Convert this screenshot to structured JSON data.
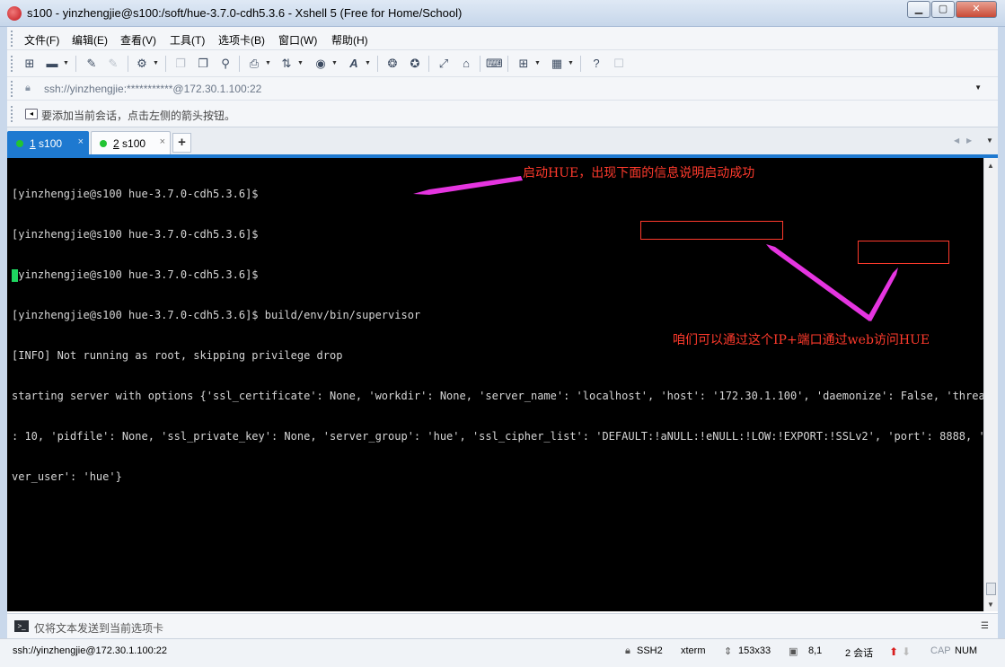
{
  "window": {
    "title": "s100 - yinzhengjie@s100:/soft/hue-3.7.0-cdh5.3.6 - Xshell 5 (Free for Home/School)",
    "min_glyph": "▁",
    "max_glyph": "▢",
    "close_glyph": "✕"
  },
  "menu": {
    "items": [
      "文件(F)",
      "编辑(E)",
      "查看(V)",
      "工具(T)",
      "选项卡(B)",
      "窗口(W)",
      "帮助(H)"
    ]
  },
  "toolbar": {
    "icons": [
      "new-session-icon",
      "open-folder-icon",
      "connect-icon",
      "disconnect-icon",
      "properties-icon",
      "copy-icon",
      "paste-icon",
      "find-icon",
      "print-icon",
      "transfer-icon",
      "globe-icon",
      "font-icon",
      "xftp-icon",
      "xmanager-icon",
      "fullscreen-icon",
      "lock-icon",
      "keyboard-icon",
      "add-tab-icon",
      "layout-icon",
      "help-icon",
      "chat-icon"
    ]
  },
  "address": {
    "value": "ssh://yinzhengjie:***********@172.30.1.100:22",
    "dropdown_glyph": "▼"
  },
  "tip": {
    "text": "要添加当前会话，点击左侧的箭头按钮。"
  },
  "tabs": [
    {
      "number": "1",
      "name": " s100",
      "close": "×",
      "status_color": "#22c432"
    },
    {
      "number": "2",
      "name": " s100",
      "close": "×",
      "status_color": "#22c432"
    }
  ],
  "tab_add_label": "+",
  "terminal": {
    "lines": [
      "[yinzhengjie@s100 hue-3.7.0-cdh5.3.6]$",
      "[yinzhengjie@s100 hue-3.7.0-cdh5.3.6]$",
      "[yinzhengjie@s100 hue-3.7.0-cdh5.3.6]$",
      "[yinzhengjie@s100 hue-3.7.0-cdh5.3.6]$ build/env/bin/supervisor",
      "[INFO] Not running as root, skipping privilege drop",
      "starting server with options {'ssl_certificate': None, 'workdir': None, 'server_name': 'localhost', 'host': '172.30.1.100', 'daemonize': False, 'threads'",
      ": 10, 'pidfile': None, 'ssl_private_key': None, 'server_group': 'hue', 'ssl_cipher_list': 'DEFAULT:!aNULL:!eNULL:!LOW:!EXPORT:!SSLv2', 'port': 8888, 'ser",
      "ver_user': 'hue'}"
    ],
    "cursor_color": "#1ed760"
  },
  "annotations": {
    "start_note": "启动HUE，出现下面的信息说明启动成功",
    "access_note": "咱们可以通过这个IP+端口通过web访问HUE",
    "color": "#ff3a2c",
    "arrow_color": "#e535e0"
  },
  "sendbar": {
    "placeholder": "仅将文本发送到当前选项卡"
  },
  "status": {
    "connection": "ssh://yinzhengjie@172.30.1.100:22",
    "protocol": "SSH2",
    "terminal_type": "xterm",
    "size": "153x33",
    "position": "8,1",
    "sessions": "2 会话",
    "caps": "CAP",
    "num": "NUM"
  }
}
